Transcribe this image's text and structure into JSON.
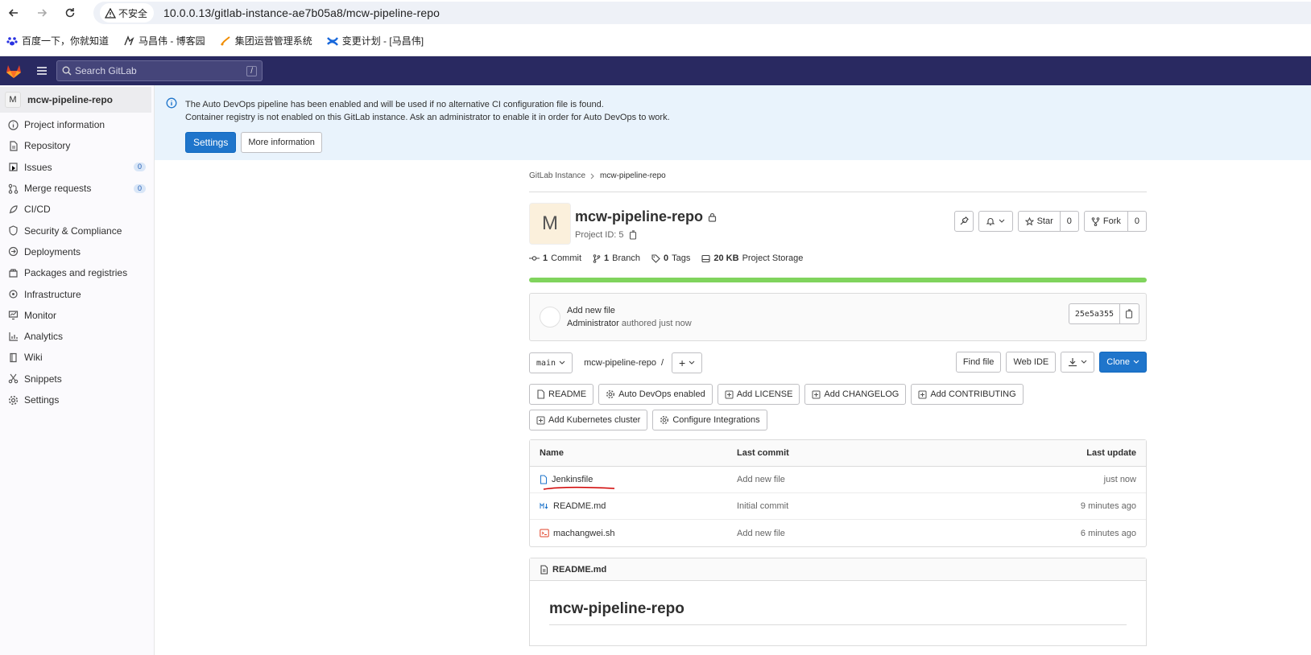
{
  "browser": {
    "insecure_label": "不安全",
    "url": "10.0.0.13/gitlab-instance-ae7b05a8/mcw-pipeline-repo",
    "bookmarks": [
      "百度一下，你就知道",
      "马昌伟 - 博客园",
      "集团运营管理系统",
      "变更计划 - [马昌伟]"
    ]
  },
  "header": {
    "search_placeholder": "Search GitLab",
    "search_shortcut": "/"
  },
  "sidebar": {
    "project_initial": "M",
    "project_name": "mcw-pipeline-repo",
    "items": [
      {
        "label": "Project information",
        "icon": "info-icon"
      },
      {
        "label": "Repository",
        "icon": "doc-icon"
      },
      {
        "label": "Issues",
        "icon": "issues-icon",
        "badge": "0"
      },
      {
        "label": "Merge requests",
        "icon": "merge-icon",
        "badge": "0"
      },
      {
        "label": "CI/CD",
        "icon": "rocket-icon"
      },
      {
        "label": "Security & Compliance",
        "icon": "shield-icon"
      },
      {
        "label": "Deployments",
        "icon": "deploy-icon"
      },
      {
        "label": "Packages and registries",
        "icon": "package-icon"
      },
      {
        "label": "Infrastructure",
        "icon": "cloud-icon"
      },
      {
        "label": "Monitor",
        "icon": "monitor-icon"
      },
      {
        "label": "Analytics",
        "icon": "chart-icon"
      },
      {
        "label": "Wiki",
        "icon": "book-icon"
      },
      {
        "label": "Snippets",
        "icon": "scissors-icon"
      },
      {
        "label": "Settings",
        "icon": "gear-icon"
      }
    ]
  },
  "banner": {
    "line1": "The Auto DevOps pipeline has been enabled and will be used if no alternative CI configuration file is found.",
    "line2": "Container registry is not enabled on this GitLab instance. Ask an administrator to enable it in order for Auto DevOps to work.",
    "settings_btn": "Settings",
    "more_btn": "More information"
  },
  "breadcrumb": {
    "parent": "GitLab Instance",
    "current": "mcw-pipeline-repo"
  },
  "project": {
    "initial": "M",
    "name": "mcw-pipeline-repo",
    "id_label": "Project ID: 5",
    "star_label": "Star",
    "star_count": "0",
    "fork_label": "Fork",
    "fork_count": "0",
    "stats": {
      "commits_num": "1",
      "commits_label": "Commit",
      "branches_num": "1",
      "branches_label": "Branch",
      "tags_num": "0",
      "tags_label": "Tags",
      "storage_num": "20 KB",
      "storage_label": "Project Storage"
    },
    "language_bar_fraction": 1.0
  },
  "commit": {
    "message": "Add new file",
    "author": "Administrator",
    "time": "authored just now",
    "sha": "25e5a355"
  },
  "tree": {
    "branch": "main",
    "path": "mcw-pipeline-repo",
    "path_sep": "/",
    "add_label": "+",
    "find_file": "Find file",
    "web_ide": "Web IDE",
    "clone": "Clone"
  },
  "quick_actions": [
    "README",
    "Auto DevOps enabled",
    "Add LICENSE",
    "Add CHANGELOG",
    "Add CONTRIBUTING",
    "Add Kubernetes cluster",
    "Configure Integrations"
  ],
  "files": {
    "headers": {
      "name": "Name",
      "last_commit": "Last commit",
      "last_update": "Last update"
    },
    "rows": [
      {
        "name": "Jenkinsfile",
        "commit": "Add new file",
        "date": "just now"
      },
      {
        "name": "README.md",
        "commit": "Initial commit",
        "date": "9 minutes ago"
      },
      {
        "name": "machangwei.sh",
        "commit": "Add new file",
        "date": "6 minutes ago"
      }
    ]
  },
  "readme": {
    "filename": "README.md",
    "title": "mcw-pipeline-repo"
  },
  "colors": {
    "header_bg": "#292961",
    "primary": "#1f75cb",
    "banner_bg": "#e9f3fc",
    "progress": "#80d45d",
    "annotation": "#d00000"
  }
}
